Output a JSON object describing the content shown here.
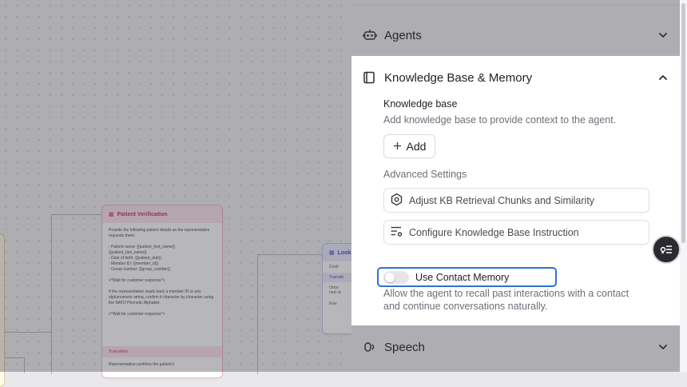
{
  "canvas": {
    "patient_node": {
      "title": "Patient Verification",
      "body": "Provide the following patient details as the representative requests them:\n\n- Patient name: {{patient_first_name}}\n  {{patient_last_name}}\n- Date of birth: {{patient_dob}}\n- Member ID: {{member_id}}\n- Group number: {{group_number}}\n\n<*Wait for customer response*>\n\nIf the representative reads back a member ID or any alphanumeric string, confirm it character by character using the NATO Phonetic Alphabet.\n\n<*Wait for customer response*>",
      "transition_label": "Transition",
      "transition_text": "Representative confirms the patient's"
    },
    "lookup_node": {
      "title": "Look",
      "row1": "Confi",
      "transition_label": "Transiti",
      "item1": "Once",
      "item1b": "next st",
      "item2": "Else"
    }
  },
  "panel": {
    "agents_label": "Agents",
    "kb_section_title": "Knowledge Base & Memory",
    "kb_label": "Knowledge base",
    "kb_description": "Add knowledge base to provide context to the agent.",
    "add_label": "Add",
    "advanced_label": "Advanced Settings",
    "option1_label": "Adjust KB Retrieval Chunks and Similarity",
    "option2_label": "Configure Knowledge Base Instruction",
    "memory_label": "Use Contact Memory",
    "memory_enabled": false,
    "memory_description": "Allow the agent to recall past interactions with a contact and continue conversations naturally.",
    "speech_label": "Speech"
  },
  "colors": {
    "accent_focus": "#2f6fde",
    "patient_node_accent": "#d43a6b",
    "lookup_node_accent": "#5b4fd8"
  },
  "icons": {
    "agents": "robot-icon",
    "knowledge": "book-icon",
    "speech": "microphone-icon",
    "chevron_down": "chevron-down-icon",
    "chevron_up": "chevron-up-icon",
    "add": "plus-icon",
    "option1": "hexagon-settings-icon",
    "option2": "list-settings-icon",
    "fab": "list-filter-icon"
  }
}
